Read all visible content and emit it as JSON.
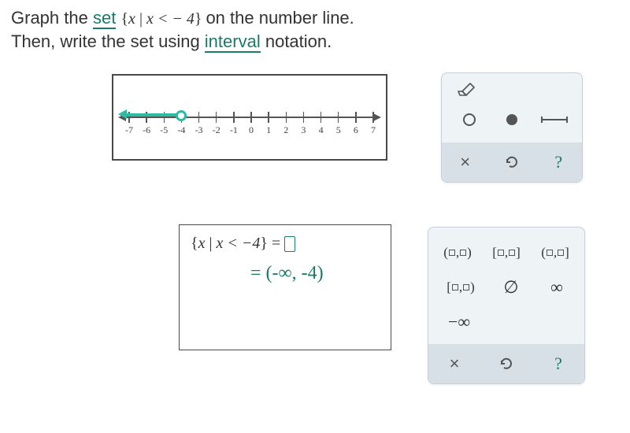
{
  "instructions": {
    "line1_pre": "Graph the ",
    "set_word": "set",
    "line1_mid_brace_open": " {",
    "line1_var": "x",
    "line1_cond": " | ",
    "line1_ineq": "x < − 4",
    "line1_brace_close": "}",
    "line1_post": " on the number line.",
    "line2_pre": "Then, write the set using ",
    "interval_word": "interval",
    "line2_post": " notation."
  },
  "numberline": {
    "ticks": [
      -7,
      -6,
      -5,
      -4,
      -3,
      -2,
      -1,
      0,
      1,
      2,
      3,
      4,
      5,
      6,
      7
    ],
    "graph": {
      "type": "open-left-ray",
      "endpoint": -4
    }
  },
  "graph_tools": {
    "open_point_title": "open point",
    "closed_point_title": "closed point",
    "segment_title": "segment",
    "clear": "×",
    "undo_title": "undo",
    "help": "?"
  },
  "answer": {
    "prefix_open": "{",
    "var": "x",
    "bar": " | ",
    "cond": "x < −4",
    "prefix_close": "}",
    "equals": " = ",
    "handwritten": "= (-∞, -4)"
  },
  "interval_tools": {
    "oo": "(□,□)",
    "cc": "[□,□]",
    "oc": "(□,□]",
    "co": "[□,□)",
    "empty": "∅",
    "inf": "∞",
    "ninf": "−∞",
    "clear": "×",
    "help": "?"
  }
}
